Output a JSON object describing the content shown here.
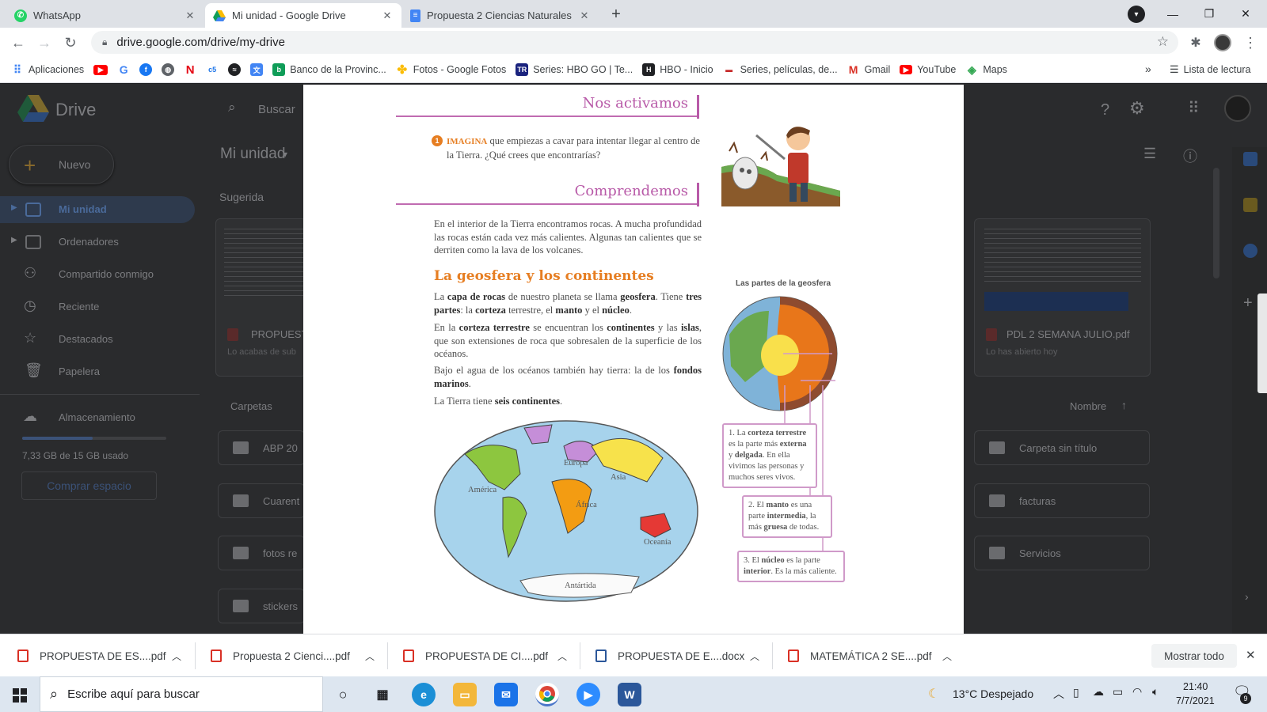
{
  "tabs": [
    {
      "title": "WhatsApp",
      "icon": "whatsapp-icon"
    },
    {
      "title": "Mi unidad - Google Drive",
      "icon": "google-drive-icon"
    },
    {
      "title": "Propuesta 2 Ciencias Naturales -",
      "icon": "google-docs-icon"
    }
  ],
  "address": {
    "url": "drive.google.com/drive/my-drive"
  },
  "bookmarks": [
    {
      "label": "Aplicaciones",
      "icon": "apps-grid-icon",
      "color": "#4285f4"
    },
    {
      "label": "",
      "icon": "youtube-icon",
      "color": "#ff0000"
    },
    {
      "label": "",
      "icon": "google-icon",
      "color": "#4285f4"
    },
    {
      "label": "",
      "icon": "facebook-icon",
      "color": "#1877f2"
    },
    {
      "label": "",
      "icon": "globe-icon",
      "color": "#5f6368"
    },
    {
      "label": "",
      "icon": "netflix-icon",
      "color": "#e50914"
    },
    {
      "label": "",
      "icon": "c5n-icon",
      "color": "#1a73e8"
    },
    {
      "label": "",
      "icon": "circle-logo-icon",
      "color": "#202124"
    },
    {
      "label": "",
      "icon": "translate-icon",
      "color": "#4285f4"
    },
    {
      "label": "Banco de la Provinc...",
      "icon": "bank-icon",
      "color": "#0f9d58"
    },
    {
      "label": "Fotos - Google Fotos",
      "icon": "google-photos-icon",
      "color": "#fbbc04"
    },
    {
      "label": "Series: HBO GO | Te...",
      "icon": "tr-icon",
      "color": "#1a237e"
    },
    {
      "label": "HBO - Inicio",
      "icon": "hbo-icon",
      "color": "#202124"
    },
    {
      "label": "Series, películas, de...",
      "icon": "movie-site-icon",
      "color": "#c62828"
    },
    {
      "label": "Gmail",
      "icon": "gmail-icon",
      "color": "#d93025"
    },
    {
      "label": "YouTube",
      "icon": "youtube-icon",
      "color": "#ff0000"
    },
    {
      "label": "Maps",
      "icon": "maps-icon",
      "color": "#34a853"
    }
  ],
  "bookmarks_overflow": "»",
  "reading_list": "Lista de lectura",
  "drive": {
    "logo": "Drive",
    "search_placeholder": "Buscar",
    "new_button": "Nuevo",
    "nav": [
      "Mi unidad",
      "Ordenadores",
      "Compartido conmigo",
      "Reciente",
      "Destacados",
      "Papelera"
    ],
    "storage_label": "Almacenamiento",
    "storage_used": "7,33 GB de 15 GB usado",
    "storage_fraction": 0.49,
    "buy_button": "Comprar espacio",
    "heading": "Mi unidad",
    "suggested": "Sugerida",
    "suggested_files": [
      {
        "name": "PROPUEST",
        "sub": "Lo acabas de sub"
      },
      {
        "name": "PDL 2 SEMANA JULIO.pdf",
        "sub": "Lo has abierto hoy"
      }
    ],
    "folders_label": "Carpetas",
    "sort_label": "Nombre",
    "folders_left": [
      "ABP 20",
      "Cuarent",
      "fotos re",
      "stickers"
    ],
    "folders_right": [
      "Carpeta sin título",
      "facturas",
      "Servicios"
    ]
  },
  "doc": {
    "section1": "Nos activamos",
    "activity_number": "1",
    "activity_keyword": "IMAGINA",
    "activity_text": "que empiezas a cavar para intentar llegar al centro de la Tierra. ¿Qué crees que encontrarías?",
    "section2": "Comprendemos",
    "intro": "En el interior de la Tierra encontramos rocas. A mucha profundidad las rocas están cada vez más calientes. Algunas tan calientes que se derriten como la lava de los volcanes.",
    "subtitle": "La geosfera y los continentes",
    "p1": {
      "a": "La ",
      "b1": "capa de rocas",
      "c": " de nuestro planeta se llama ",
      "b2": "geosfera",
      "d": ". Tiene ",
      "b3": "tres partes",
      "e": ": la ",
      "b4": "corteza",
      "f": " terrestre, el ",
      "b5": "manto",
      "g": " y el ",
      "b6": "núcleo",
      "h": "."
    },
    "p2": {
      "a": "En la ",
      "b1": "corteza terrestre",
      "c": " se encuentran los ",
      "b2": "continentes",
      "d": " y las ",
      "b3": "islas",
      "e": ", que son extensiones de roca que sobresalen de la superficie de los océanos."
    },
    "p3": {
      "a": "Bajo el agua de los océanos también hay tierra: la de los ",
      "b1": "fondos marinos",
      "c": "."
    },
    "p4": {
      "a": "La Tierra tiene ",
      "b1": "seis continentes",
      "c": "."
    },
    "geo_title": "Las partes de la geosfera",
    "map_labels": [
      "Europa",
      "Asia",
      "América",
      "África",
      "Oceanía",
      "Antártida"
    ],
    "callout1": {
      "a": "1. La ",
      "b1": "corteza terrestre",
      "c": " es la parte más ",
      "b2": "externa",
      "d": " y ",
      "b3": "delgada",
      "e": ". En ella vivimos las personas y muchos seres vivos."
    },
    "callout2": {
      "a": "2. El ",
      "b1": "manto",
      "c": " es una parte ",
      "b2": "intermedia",
      "d": ", la más ",
      "b3": "gruesa",
      "e": " de todas."
    },
    "callout3": {
      "a": "3. El ",
      "b1": "núcleo",
      "c": " es la parte ",
      "b2": "interior",
      "d": ". Es la más caliente."
    }
  },
  "downloads": [
    {
      "name": "PROPUESTA DE ES....pdf",
      "type": "pdf"
    },
    {
      "name": "Propuesta 2 Cienci....pdf",
      "type": "pdf"
    },
    {
      "name": "PROPUESTA DE CI....pdf",
      "type": "pdf"
    },
    {
      "name": "PROPUESTA DE E....docx",
      "type": "docx"
    },
    {
      "name": "MATEMÁTICA 2 SE....pdf",
      "type": "pdf"
    }
  ],
  "show_all": "Mostrar todo",
  "taskbar": {
    "search_placeholder": "Escribe aquí para buscar",
    "weather": "13°C  Despejado",
    "time": "21:40",
    "date": "7/7/2021",
    "notifications": "9"
  }
}
